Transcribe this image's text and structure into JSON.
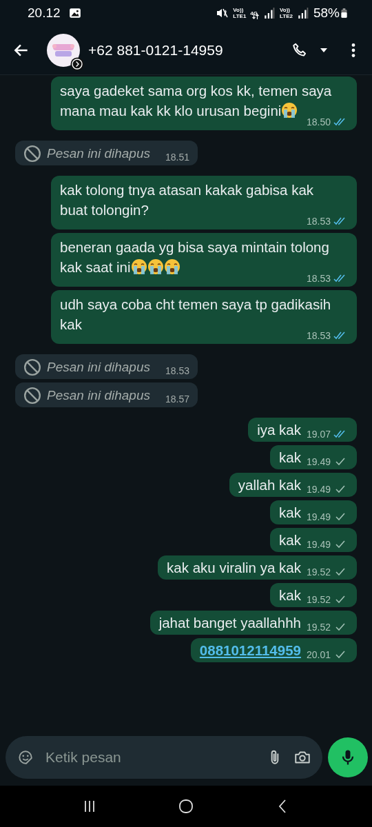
{
  "status_bar": {
    "time": "20.12",
    "battery": "58%",
    "sim1": "Vo))\nLTE1",
    "network": "4G",
    "sim2": "Vo))\nLTE2"
  },
  "header": {
    "title": "+62 881-0121-14959"
  },
  "messages": [
    {
      "kind": "sent",
      "text": "saya gadeket sama org kos kk, temen saya mana mau kak kk klo urusan begini",
      "emojis": [
        {
          "kind": "crying"
        }
      ],
      "time": "18.50",
      "read": true
    },
    {
      "kind": "deleted",
      "text": "Pesan ini dihapus",
      "time": "18.51"
    },
    {
      "kind": "sent",
      "text": "kak tolong tnya atasan kakak gabisa kak buat tolongin?",
      "time": "18.53",
      "read": true
    },
    {
      "kind": "sent",
      "text": "beneran gaada yg bisa saya mintain tolong kak saat ini",
      "emojis": [
        {
          "kind": "crying"
        },
        {
          "kind": "crying"
        },
        {
          "kind": "crying"
        }
      ],
      "time": "18.53",
      "read": true
    },
    {
      "kind": "sent",
      "text": "udh saya coba cht temen saya tp gadikasih kak",
      "time": "18.53",
      "read": true
    },
    {
      "kind": "deleted",
      "text": "Pesan ini dihapus",
      "time": "18.53"
    },
    {
      "kind": "deleted",
      "text": "Pesan ini dihapus",
      "time": "18.57"
    },
    {
      "kind": "sent",
      "text": "iya kak",
      "time": "19.07",
      "read": true
    },
    {
      "kind": "sent",
      "text": "kak",
      "time": "19.49",
      "read": false
    },
    {
      "kind": "sent",
      "text": "yallah kak",
      "time": "19.49",
      "read": false
    },
    {
      "kind": "sent",
      "text": "kak",
      "time": "19.49",
      "read": false
    },
    {
      "kind": "sent",
      "text": "kak",
      "time": "19.49",
      "read": false
    },
    {
      "kind": "sent",
      "text": "kak aku viralin ya kak",
      "time": "19.52",
      "read": false
    },
    {
      "kind": "sent",
      "text": "kak",
      "time": "19.52",
      "read": false
    },
    {
      "kind": "sent",
      "text": "jahat banget yaallahhh",
      "time": "19.52",
      "read": false
    },
    {
      "kind": "sent",
      "text": "0881012114959",
      "link": true,
      "time": "20.01",
      "read": false
    }
  ],
  "composer": {
    "placeholder": "Ketik pesan"
  }
}
